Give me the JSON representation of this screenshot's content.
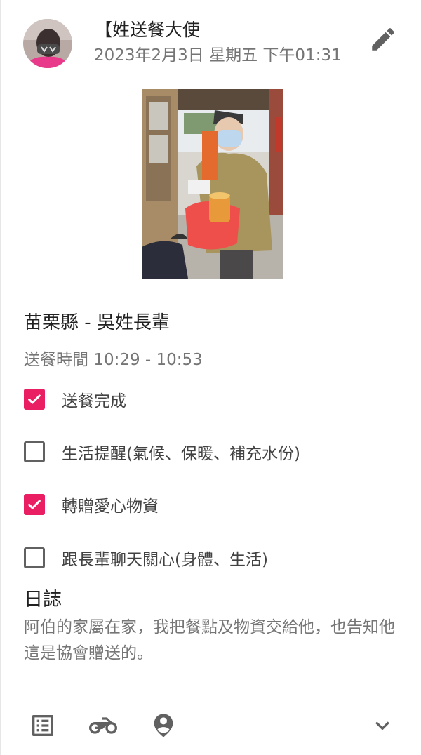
{
  "post": {
    "author": "【姓送餐大使",
    "datetime": "2023年2月3日 星期五 下午01:31",
    "edit_icon": "pencil-icon"
  },
  "delivery": {
    "recipient": "苗栗縣 - 吳姓長輩",
    "time": "送餐時間 10:29 - 10:53",
    "checklist": [
      {
        "label": "送餐完成",
        "checked": true
      },
      {
        "label": "生活提醒(氣候、保暖、補充水份)",
        "checked": false
      },
      {
        "label": "轉贈愛心物資",
        "checked": true
      },
      {
        "label": "跟長輩聊天關心(身體、生活)",
        "checked": false
      }
    ]
  },
  "log": {
    "title": "日誌",
    "text": "阿伯的家屬在家，我把餐點及物資交給他，也告知他這是協會贈送的。"
  },
  "footer": {
    "icons": [
      "list-alt-icon",
      "motorcycle-icon",
      "person-pin-icon",
      "chevron-down-icon"
    ]
  },
  "colors": {
    "accent": "#e91e63",
    "text_primary": "#212121",
    "text_secondary": "#757575",
    "icon": "#616161"
  }
}
